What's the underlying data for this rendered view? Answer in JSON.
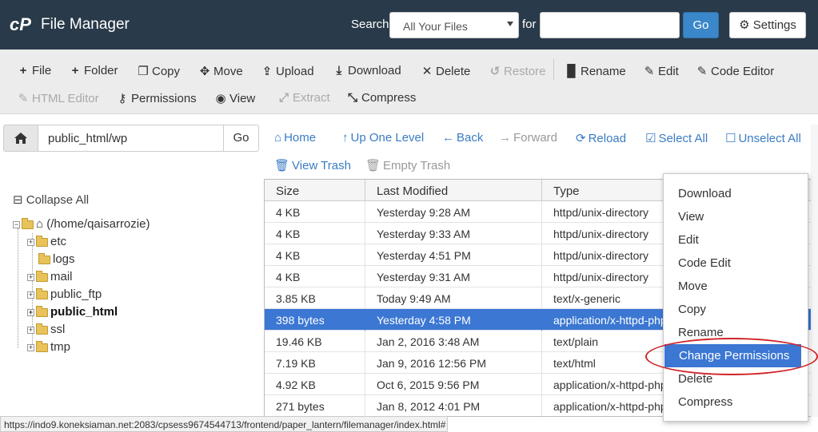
{
  "header": {
    "logo": "cP",
    "title": "File Manager",
    "search_label": "Search",
    "search_scope": "All Your Files",
    "for_label": "for",
    "search_value": "",
    "go_label": "Go",
    "settings_label": "Settings",
    "bg_color": "#293a4a",
    "accent_color": "#3a87c9"
  },
  "toolbar": {
    "file": "File",
    "folder": "Folder",
    "copy": "Copy",
    "move": "Move",
    "upload": "Upload",
    "download": "Download",
    "delete": "Delete",
    "restore": "Restore",
    "rename": "Rename",
    "edit": "Edit",
    "code_editor": "Code Editor",
    "html_editor": "HTML Editor",
    "permissions": "Permissions",
    "view": "View",
    "extract": "Extract",
    "compress": "Compress"
  },
  "path": {
    "value": "public_html/wp",
    "go_label": "Go"
  },
  "nav": {
    "home": "Home",
    "up_one_level": "Up One Level",
    "back": "Back",
    "forward": "Forward",
    "reload": "Reload",
    "select_all": "Select All",
    "unselect_all": "Unselect All",
    "view_trash": "View Trash",
    "empty_trash": "Empty Trash"
  },
  "tree": {
    "collapse_all": "Collapse All",
    "root": "(/home/qaisarrozie)",
    "folders": [
      "etc",
      "logs",
      "mail",
      "public_ftp",
      "public_html",
      "ssl",
      "tmp"
    ]
  },
  "table": {
    "headers": [
      "Size",
      "Last Modified",
      "Type"
    ],
    "rows": [
      {
        "size": "4 KB",
        "modified": "Yesterday 9:28 AM",
        "type": "httpd/unix-directory"
      },
      {
        "size": "4 KB",
        "modified": "Yesterday 9:33 AM",
        "type": "httpd/unix-directory"
      },
      {
        "size": "4 KB",
        "modified": "Yesterday 4:51 PM",
        "type": "httpd/unix-directory"
      },
      {
        "size": "4 KB",
        "modified": "Yesterday 9:31 AM",
        "type": "httpd/unix-directory"
      },
      {
        "size": "3.85 KB",
        "modified": "Today 9:49 AM",
        "type": "text/x-generic"
      },
      {
        "size": "398 bytes",
        "modified": "Yesterday 4:58 PM",
        "type": "application/x-httpd-php"
      },
      {
        "size": "19.46 KB",
        "modified": "Jan 2, 2016 3:48 AM",
        "type": "text/plain"
      },
      {
        "size": "7.19 KB",
        "modified": "Jan 9, 2016 12:56 PM",
        "type": "text/html"
      },
      {
        "size": "4.92 KB",
        "modified": "Oct 6, 2015 9:56 PM",
        "type": "application/x-httpd-php"
      },
      {
        "size": "271 bytes",
        "modified": "Jan 8, 2012 4:01 PM",
        "type": "application/x-httpd-php"
      }
    ],
    "selected_row_color": "#3b77d3"
  },
  "context_menu": {
    "items": [
      "Download",
      "View",
      "Edit",
      "Code Edit",
      "Move",
      "Copy",
      "Rename",
      "Change Permissions",
      "Delete",
      "Compress"
    ],
    "active": "Change Permissions",
    "highlight_color": "#d0242a"
  },
  "status": {
    "url": "https://indo9.koneksiaman.net:2083/cpsess9674544713/frontend/paper_lantern/filemanager/index.html#"
  }
}
